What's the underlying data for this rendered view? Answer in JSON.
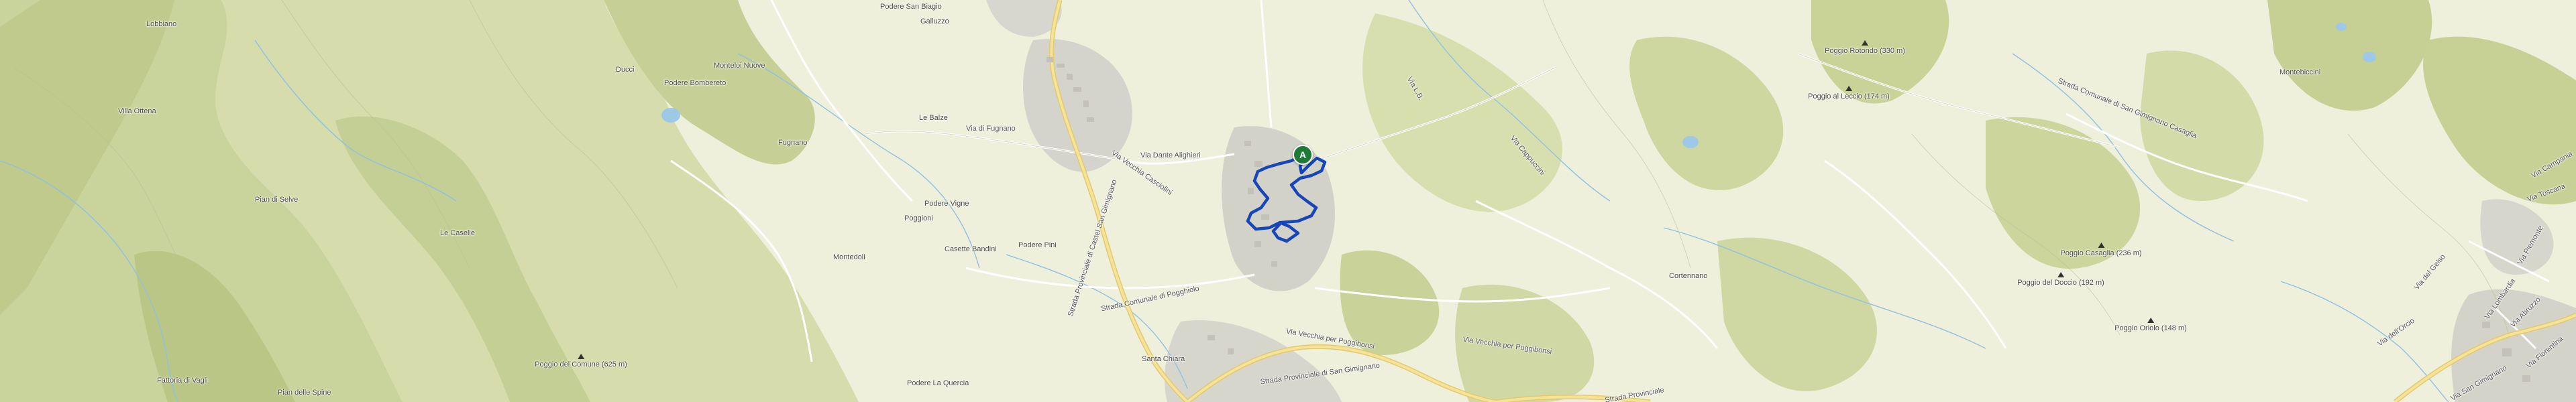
{
  "map": {
    "route_color": "#1646b8",
    "start_marker": {
      "label": "A",
      "color": "#1f7a37"
    },
    "labels": [
      {
        "id": "lbl-lobbiano",
        "text": "Lobbiano",
        "kind": "place"
      },
      {
        "id": "lbl-podere-san-biagio",
        "text": "Podere San Biagio",
        "kind": "place"
      },
      {
        "id": "lbl-galluzzo",
        "text": "Galluzzo",
        "kind": "place"
      },
      {
        "id": "lbl-podere-bombereto",
        "text": "Podere Bombereto",
        "kind": "place"
      },
      {
        "id": "lbl-villa-ottena",
        "text": "Villa Ottena",
        "kind": "place"
      },
      {
        "id": "lbl-ducci",
        "text": "Ducci",
        "kind": "place"
      },
      {
        "id": "lbl-monteloi-nuove",
        "text": "Monteloi Nuove",
        "kind": "place"
      },
      {
        "id": "lbl-le-balze",
        "text": "Le Balze",
        "kind": "place"
      },
      {
        "id": "lbl-via-di-fugnano",
        "text": "Via di Fugnano",
        "kind": "road"
      },
      {
        "id": "lbl-fugnano",
        "text": "Fugnano",
        "kind": "place"
      },
      {
        "id": "lbl-via-dante-alighieri",
        "text": "Via Dante Alighieri",
        "kind": "road"
      },
      {
        "id": "lbl-via-vecchia-casciolini",
        "text": "Via Vecchia Casciolini",
        "kind": "road"
      },
      {
        "id": "lbl-pian-di-selve",
        "text": "Pian di Selve",
        "kind": "place"
      },
      {
        "id": "lbl-podere-vigne",
        "text": "Podere Vigne",
        "kind": "place"
      },
      {
        "id": "lbl-poggioni",
        "text": "Poggioni",
        "kind": "place"
      },
      {
        "id": "lbl-le-caselle",
        "text": "Le Caselle",
        "kind": "place"
      },
      {
        "id": "lbl-casette-bandini",
        "text": "Casette Bandini",
        "kind": "place"
      },
      {
        "id": "lbl-podere-pini",
        "text": "Podere Pini",
        "kind": "place"
      },
      {
        "id": "lbl-montedoli",
        "text": "Montedoli",
        "kind": "place"
      },
      {
        "id": "lbl-strada-comunale-di-pogghiolo",
        "text": "Strada Comunale di Pogghiolo",
        "kind": "road"
      },
      {
        "id": "lbl-strada-provinciale-1",
        "text": "Strada Provinciale di Castel San Gimignano",
        "kind": "road"
      },
      {
        "id": "lbl-poggio-del-comune",
        "text": "Poggio del Comune (625 m)",
        "kind": "peak"
      },
      {
        "id": "lbl-fattoria-di-vagli",
        "text": "Fattoria di Vagli",
        "kind": "place"
      },
      {
        "id": "lbl-pian-delle-spine",
        "text": "Pian delle Spine",
        "kind": "place"
      },
      {
        "id": "lbl-santa-chiara",
        "text": "Santa Chiara",
        "kind": "place"
      },
      {
        "id": "lbl-podere-la-quercia",
        "text": "Podere La Quercia",
        "kind": "place"
      },
      {
        "id": "lbl-via-vecchia-per-poggibonsi",
        "text": "Via Vecchia per Poggibonsi",
        "kind": "road"
      },
      {
        "id": "lbl-via-vecchia-per-poggibonsi-2",
        "text": "Via Vecchia per Poggibonsi",
        "kind": "road"
      },
      {
        "id": "lbl-strada-provinciale-2",
        "text": "Strada Provinciale di San Gimignano",
        "kind": "road"
      },
      {
        "id": "lbl-strada-provinciale-3",
        "text": "Strada Provinciale",
        "kind": "road"
      },
      {
        "id": "lbl-via-cappuccini",
        "text": "Via Cappuccini",
        "kind": "road"
      },
      {
        "id": "lbl-via-l-b",
        "text": "Via L.B.",
        "kind": "road"
      },
      {
        "id": "lbl-poggio-rotondo",
        "text": "Poggio Rotondo (330 m)",
        "kind": "peak"
      },
      {
        "id": "lbl-poggio-al-leccio",
        "text": "Poggio al Leccio (174 m)",
        "kind": "peak"
      },
      {
        "id": "lbl-strada-comunale-casaglia",
        "text": "Strada Comunale di San Gimignano Casaglia",
        "kind": "road"
      },
      {
        "id": "lbl-montebiccini",
        "text": "Montebiccini",
        "kind": "place"
      },
      {
        "id": "lbl-poggio-casaglia",
        "text": "Poggio Casaglia (236 m)",
        "kind": "peak"
      },
      {
        "id": "lbl-poggio-del-doccio",
        "text": "Poggio del Doccio (192 m)",
        "kind": "peak"
      },
      {
        "id": "lbl-poggio-oriolo",
        "text": "Poggio Oriolo (148 m)",
        "kind": "peak"
      },
      {
        "id": "lbl-cortennano",
        "text": "Cortennano",
        "kind": "place"
      },
      {
        "id": "lbl-via-campania",
        "text": "Via Campania",
        "kind": "road"
      },
      {
        "id": "lbl-via-toscana",
        "text": "Via Toscana",
        "kind": "road"
      },
      {
        "id": "lbl-via-lombardia",
        "text": "Via Lombardia",
        "kind": "road"
      },
      {
        "id": "lbl-via-abruzzo",
        "text": "Via Abruzzo",
        "kind": "road"
      },
      {
        "id": "lbl-via-san-gimignano",
        "text": "Via San Gimignano",
        "kind": "road"
      },
      {
        "id": "lbl-via-fiorentina",
        "text": "Via Fiorentina",
        "kind": "road"
      },
      {
        "id": "lbl-via-piemonte",
        "text": "Via Piemonte",
        "kind": "road"
      },
      {
        "id": "lbl-via-dell-orcio",
        "text": "Via dell'Orcio",
        "kind": "road"
      },
      {
        "id": "lbl-via-del-gelso",
        "text": "Via del Gelso",
        "kind": "road"
      }
    ]
  }
}
